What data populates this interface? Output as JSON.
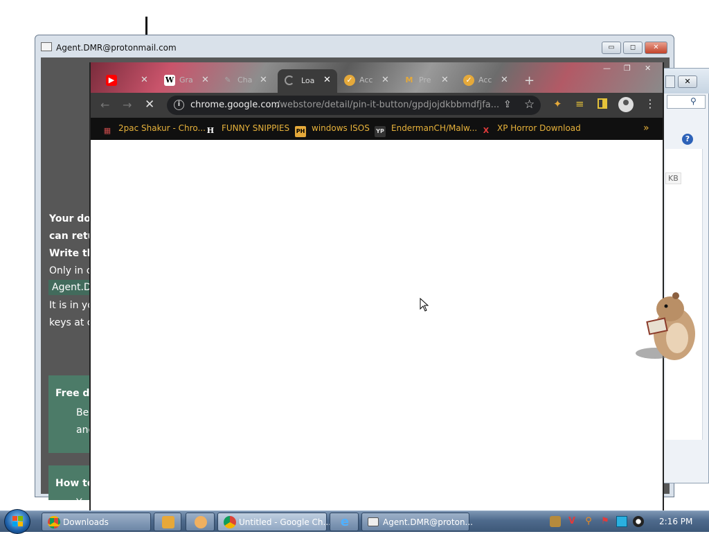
{
  "back_window": {
    "title": "Agent.DMR@protonmail.com",
    "minimize_label": "▭",
    "maximize_label": "◻",
    "close_label": "✕",
    "note_lines": [
      "Your do",
      "can retu",
      "Write th",
      "Only in c",
      "Agent.D",
      "It is in yo",
      "keys at c"
    ],
    "free_box": {
      "title": "Free d",
      "line1": "Be",
      "line2": "and"
    },
    "howto_box": {
      "title": "How to",
      "line1": "Yo"
    }
  },
  "right_window": {
    "close_label": "✕",
    "search_icon": "search-icon",
    "help_label": "?",
    "size_text": "KB"
  },
  "chrome": {
    "tabs": [
      {
        "label": "",
        "icon": "youtube-icon",
        "color": "#ff0000"
      },
      {
        "label": "Gra",
        "icon": "wikipedia-icon",
        "color": "#ffffff"
      },
      {
        "label": "Cha",
        "icon": "quill-icon",
        "color": "#888888"
      },
      {
        "label": "Loa",
        "icon": "loading-icon",
        "active": true
      },
      {
        "label": "Acc",
        "icon": "badge-icon",
        "color": "#e5a93a"
      },
      {
        "label": "Pre",
        "icon": "mcdonalds-icon",
        "color": "#e5a93a"
      },
      {
        "label": "Acc",
        "icon": "badge-icon",
        "color": "#e5a93a"
      }
    ],
    "newtab_label": "+",
    "window_controls": {
      "minimize": "—",
      "maximize": "❐",
      "close": "✕"
    },
    "url": {
      "host": "chrome.google.com",
      "path": "/webstore/detail/pin-it-button/gpdjojdkbbmdfjfa..."
    },
    "bookmarks": [
      {
        "label": "2pac Shakur - Chro...",
        "icon": "tupac-icon",
        "icon_text": "▦",
        "color": "#c84b4b"
      },
      {
        "label": "FUNNY SNIPPIES",
        "icon": "h-icon",
        "icon_text": "H",
        "color": "#ffffff"
      },
      {
        "label": "windows ISOS",
        "icon": "ph-icon",
        "icon_text": "PH",
        "color": "#e5a93a"
      },
      {
        "label": "EndermanCH/Malw...",
        "icon": "yp-icon",
        "icon_text": "YP",
        "color": "#bbbbbb"
      },
      {
        "label": "XP Horror Download",
        "icon": "x-icon",
        "icon_text": "X",
        "color": "#e23b3b"
      }
    ],
    "bookmarks_more": "»"
  },
  "taskbar": {
    "items": [
      {
        "label": "Downloads",
        "icon": "chrome-icon"
      },
      {
        "label": "",
        "icon": "media-player-icon"
      },
      {
        "label": "",
        "icon": "paint-icon"
      },
      {
        "label": "Untitled - Google Ch...",
        "icon": "chrome-icon"
      },
      {
        "label": "",
        "icon": "ie-icon"
      },
      {
        "label": "Agent.DMR@proton...",
        "icon": "window-icon"
      }
    ],
    "clock": "2:16 PM"
  }
}
